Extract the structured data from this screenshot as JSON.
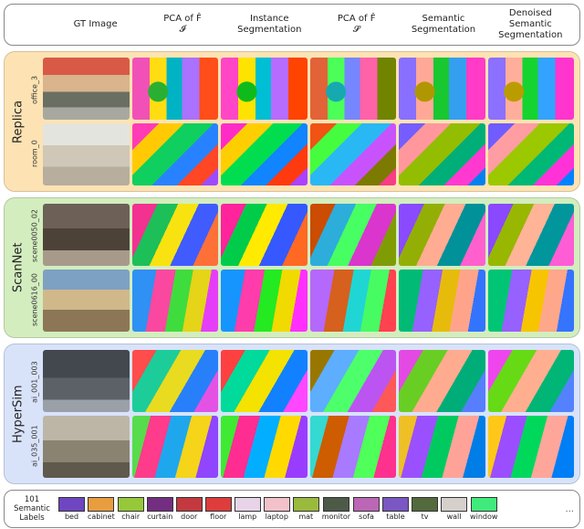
{
  "columns": [
    {
      "line1": "GT Image",
      "line2": ""
    },
    {
      "line1": "PCA of F̂",
      "line2": "𝓘"
    },
    {
      "line1": "Instance",
      "line2": "Segmentation"
    },
    {
      "line1": "PCA of F̂",
      "line2": "𝓢"
    },
    {
      "line1": "Semantic",
      "line2": "Segmentation"
    },
    {
      "line1": "Denoised Semantic",
      "line2": "Segmentation"
    }
  ],
  "datasets": [
    {
      "name": "Replica",
      "cls": "replica",
      "scenes": [
        "office_3",
        "room_0"
      ],
      "gt": [
        "gt1",
        "gt2"
      ],
      "seg": [
        "seg1",
        "seg2"
      ]
    },
    {
      "name": "ScanNet",
      "cls": "scannet",
      "scenes": [
        "scene0050_02",
        "scene0616_00"
      ],
      "gt": [
        "gt3",
        "gt4"
      ],
      "seg": [
        "seg3",
        "seg4"
      ]
    },
    {
      "name": "HyperSim",
      "cls": "hypersim",
      "scenes": [
        "ai_001_003",
        "ai_035_001"
      ],
      "gt": [
        "gt5",
        "gt6"
      ],
      "seg": [
        "seg5",
        "seg6"
      ]
    }
  ],
  "variants": [
    "",
    "pca-inst",
    "inst",
    "pca-sem",
    "sem",
    "dsem"
  ],
  "legend": {
    "title_l1": "101",
    "title_l2": "Semantic",
    "title_l3": "Labels",
    "items": [
      {
        "label": "bed",
        "color": "#6f46c2"
      },
      {
        "label": "cabinet",
        "color": "#e89d3f"
      },
      {
        "label": "chair",
        "color": "#97c83a"
      },
      {
        "label": "curtain",
        "color": "#742e81"
      },
      {
        "label": "door",
        "color": "#c3393f"
      },
      {
        "label": "floor",
        "color": "#df3c3c"
      },
      {
        "label": "lamp",
        "color": "#e7d4e8"
      },
      {
        "label": "laptop",
        "color": "#f3c1ca"
      },
      {
        "label": "mat",
        "color": "#9aba3d"
      },
      {
        "label": "monitor",
        "color": "#4e5a48"
      },
      {
        "label": "sofa",
        "color": "#bb67b5"
      },
      {
        "label": "table",
        "color": "#7a57c2"
      },
      {
        "label": "tv",
        "color": "#536a3d"
      },
      {
        "label": "wall",
        "color": "#d5d0cc"
      },
      {
        "label": "window",
        "color": "#40eb7c"
      }
    ],
    "ellipsis": "..."
  }
}
